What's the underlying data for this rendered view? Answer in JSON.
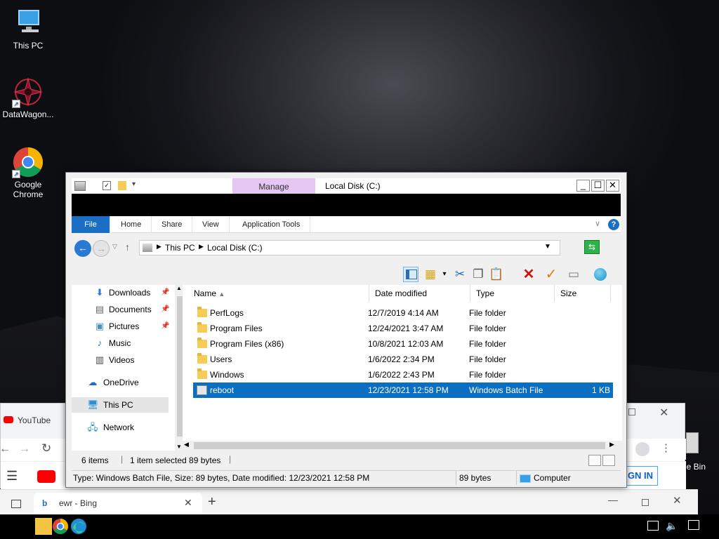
{
  "desktop": {
    "icons": [
      {
        "label": "This PC"
      },
      {
        "label": "DataWagon..."
      },
      {
        "label": "Google Chrome"
      }
    ],
    "recycle_bin_partial": "le Bin"
  },
  "chrome_bg": {
    "tab_label": "YouTube",
    "signin_partial": "GN IN"
  },
  "edge_bg": {
    "tab_label": "ewr - Bing"
  },
  "explorer": {
    "manage_label": "Manage",
    "title": "Local Disk (C:)",
    "ribbon_tabs": [
      "File",
      "Home",
      "Share",
      "View",
      "Application Tools"
    ],
    "breadcrumb": [
      "This PC",
      "Local Disk (C:)"
    ],
    "nav": [
      {
        "label": "Downloads",
        "icon": "download-icon",
        "pinned": true
      },
      {
        "label": "Documents",
        "icon": "document-icon",
        "pinned": true
      },
      {
        "label": "Pictures",
        "icon": "pictures-icon",
        "pinned": true
      },
      {
        "label": "Music",
        "icon": "music-icon",
        "pinned": false
      },
      {
        "label": "Videos",
        "icon": "video-icon",
        "pinned": false
      },
      {
        "label": "OneDrive",
        "icon": "cloud-icon",
        "pinned": false
      },
      {
        "label": "This PC",
        "icon": "computer-icon",
        "pinned": false
      },
      {
        "label": "Network",
        "icon": "network-icon",
        "pinned": false
      }
    ],
    "columns": [
      "Name",
      "Date modified",
      "Type",
      "Size"
    ],
    "files": [
      {
        "name": "PerfLogs",
        "date": "12/7/2019 4:14 AM",
        "type": "File folder",
        "size": ""
      },
      {
        "name": "Program Files",
        "date": "12/24/2021 3:47 AM",
        "type": "File folder",
        "size": ""
      },
      {
        "name": "Program Files (x86)",
        "date": "10/8/2021 12:03 AM",
        "type": "File folder",
        "size": ""
      },
      {
        "name": "Users",
        "date": "1/6/2022 2:34 PM",
        "type": "File folder",
        "size": ""
      },
      {
        "name": "Windows",
        "date": "1/6/2022 2:43 PM",
        "type": "File folder",
        "size": ""
      },
      {
        "name": "reboot",
        "date": "12/23/2021 12:58 PM",
        "type": "Windows Batch File",
        "size": "1 KB"
      }
    ],
    "status": {
      "items": "6 items",
      "selected": "1 item selected  89 bytes",
      "detail": "Type: Windows Batch File, Size: 89 bytes, Date modified: 12/23/2021 12:58 PM",
      "size": "89 bytes",
      "location": "Computer"
    }
  },
  "colors": {
    "selection": "#0a6fc2",
    "file_tab": "#1a6fc4",
    "manage_tab": "#e6c6f2"
  }
}
